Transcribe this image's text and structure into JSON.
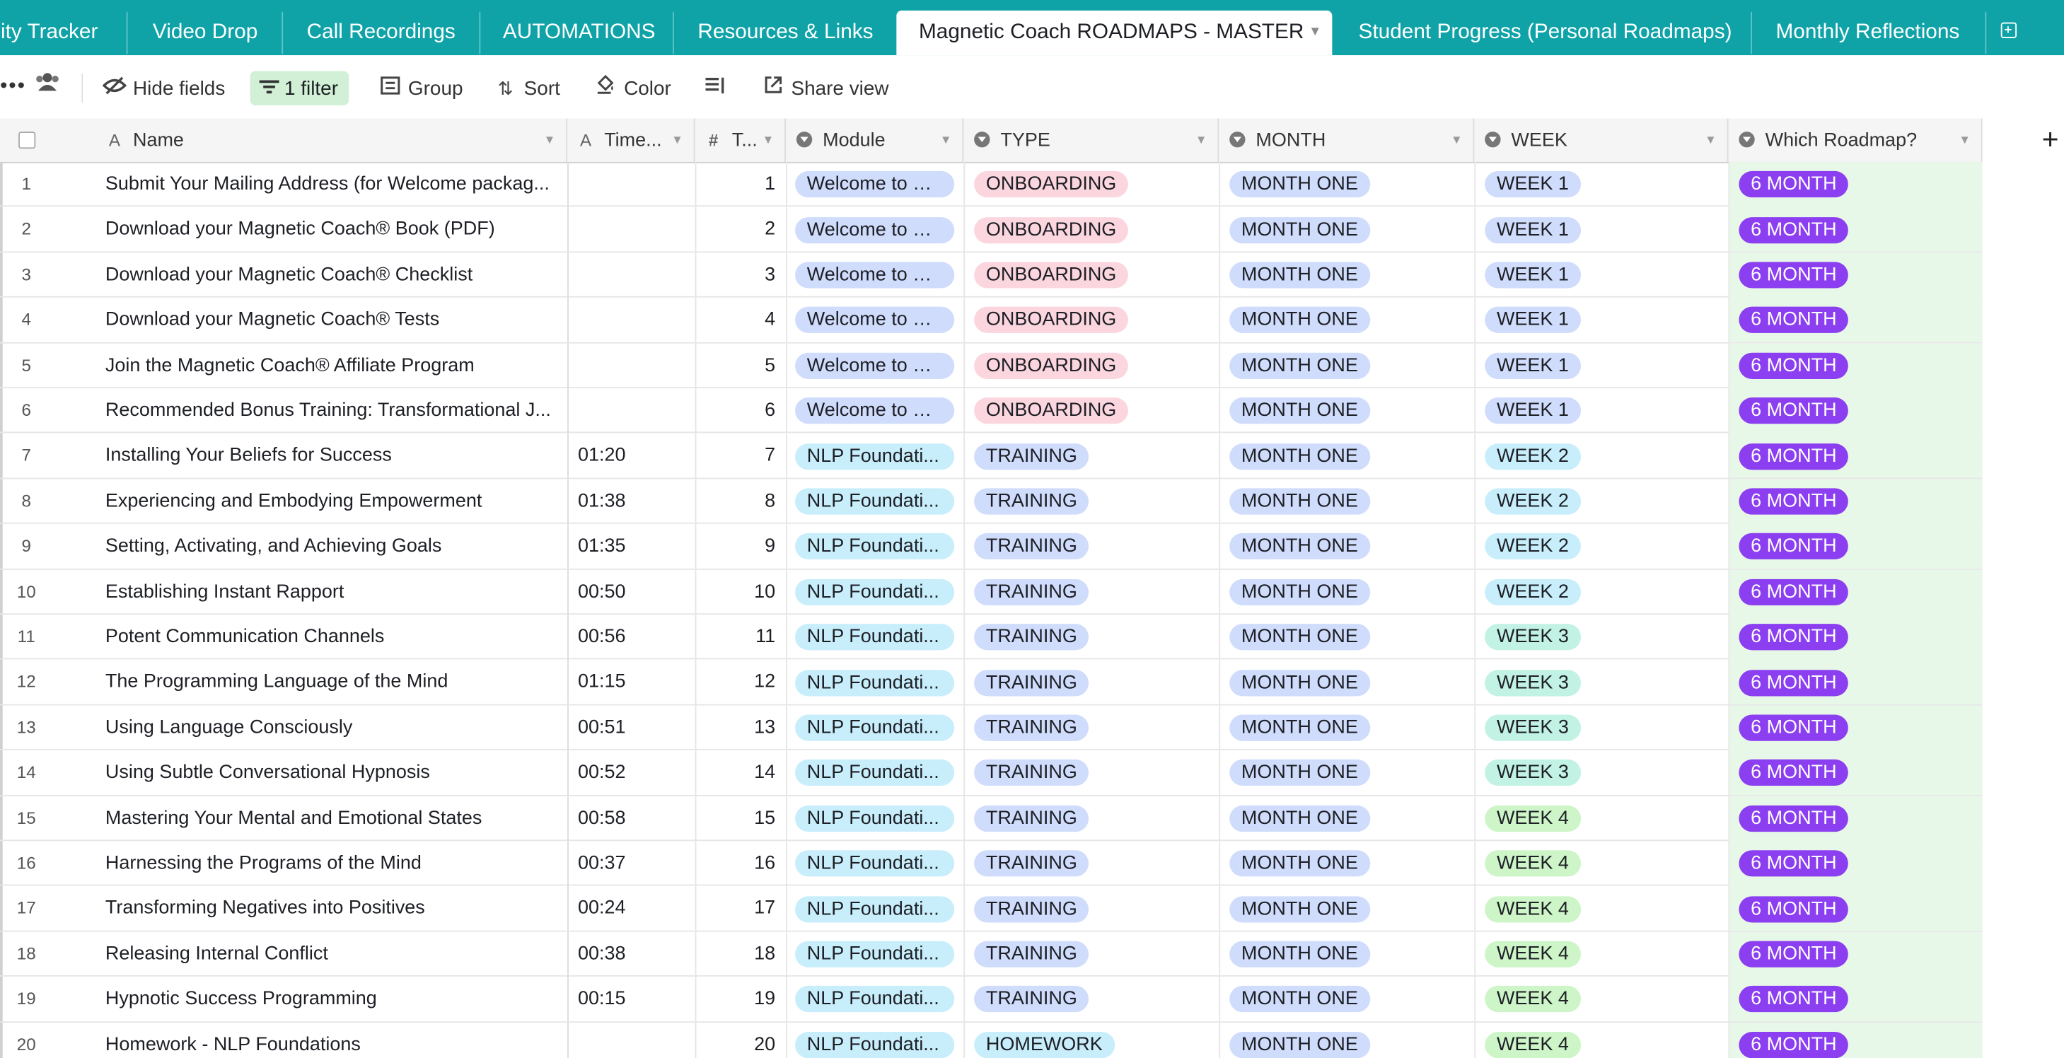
{
  "tabs": [
    {
      "label": "lity Tracker",
      "active": false
    },
    {
      "label": "Video Drop",
      "active": false
    },
    {
      "label": "Call Recordings",
      "active": false
    },
    {
      "label": "AUTOMATIONS",
      "active": false
    },
    {
      "label": "Resources & Links",
      "active": false
    },
    {
      "label": "Magnetic Coach ROADMAPS - MASTER",
      "active": true
    },
    {
      "label": "Student Progress (Personal Roadmaps)",
      "active": false
    },
    {
      "label": "Monthly Reflections",
      "active": false
    }
  ],
  "toolbar": {
    "hide_fields": "Hide fields",
    "filter": "1 filter",
    "group": "Group",
    "sort": "Sort",
    "color": "Color",
    "share_view": "Share view"
  },
  "columns": {
    "name": "Name",
    "time": "Time...",
    "t": "T...",
    "module": "Module",
    "type": "TYPE",
    "month": "MONTH",
    "week": "WEEK",
    "roadmap": "Which Roadmap?"
  },
  "colors": {
    "tab_bar": "#0fa3a8",
    "filter_bg": "#d1f0d5",
    "roadmap_col_bg": "#e8f8e8",
    "pill_roadmap": "#8b3ff0"
  },
  "pill_styles": {
    "Welcome to M...": {
      "bg": "#cfdcfb",
      "fg": "#1d1f25"
    },
    "NLP Foundati...": {
      "bg": "#c8eefc",
      "fg": "#1d1f25"
    },
    "ONBOARDING": {
      "bg": "#fbd6df",
      "fg": "#1d1f25"
    },
    "TRAINING": {
      "bg": "#cfdcfb",
      "fg": "#1d1f25"
    },
    "HOMEWORK": {
      "bg": "#c8eefc",
      "fg": "#1d1f25"
    },
    "MONTH ONE": {
      "bg": "#cfdcfb",
      "fg": "#1d1f25"
    },
    "WEEK 1": {
      "bg": "#cfdcfb",
      "fg": "#1d1f25"
    },
    "WEEK 2": {
      "bg": "#c8eefc",
      "fg": "#1d1f25"
    },
    "WEEK 3": {
      "bg": "#c2f2e4",
      "fg": "#1d1f25"
    },
    "WEEK 4": {
      "bg": "#cdf5c8",
      "fg": "#1d1f25"
    },
    "6 MONTH": {
      "bg": "#8b3ff0",
      "fg": "#ffffff"
    }
  },
  "rows": [
    {
      "num": "1",
      "name": "Submit Your Mailing Address (for Welcome packag...",
      "time": "",
      "t": "1",
      "module": "Welcome to M...",
      "type": "ONBOARDING",
      "month": "MONTH ONE",
      "week": "WEEK 1",
      "roadmap": "6 MONTH"
    },
    {
      "num": "2",
      "name": "Download your Magnetic Coach® Book (PDF)",
      "time": "",
      "t": "2",
      "module": "Welcome to M...",
      "type": "ONBOARDING",
      "month": "MONTH ONE",
      "week": "WEEK 1",
      "roadmap": "6 MONTH"
    },
    {
      "num": "3",
      "name": "Download your Magnetic Coach® Checklist",
      "time": "",
      "t": "3",
      "module": "Welcome to M...",
      "type": "ONBOARDING",
      "month": "MONTH ONE",
      "week": "WEEK 1",
      "roadmap": "6 MONTH"
    },
    {
      "num": "4",
      "name": "Download your Magnetic Coach® Tests",
      "time": "",
      "t": "4",
      "module": "Welcome to M...",
      "type": "ONBOARDING",
      "month": "MONTH ONE",
      "week": "WEEK 1",
      "roadmap": "6 MONTH"
    },
    {
      "num": "5",
      "name": "Join the Magnetic Coach® Affiliate Program",
      "time": "",
      "t": "5",
      "module": "Welcome to M...",
      "type": "ONBOARDING",
      "month": "MONTH ONE",
      "week": "WEEK 1",
      "roadmap": "6 MONTH"
    },
    {
      "num": "6",
      "name": "Recommended Bonus Training: Transformational J...",
      "time": "",
      "t": "6",
      "module": "Welcome to M...",
      "type": "ONBOARDING",
      "month": "MONTH ONE",
      "week": "WEEK 1",
      "roadmap": "6 MONTH"
    },
    {
      "num": "7",
      "name": "Installing Your Beliefs for Success",
      "time": "01:20",
      "t": "7",
      "module": "NLP Foundati...",
      "type": "TRAINING",
      "month": "MONTH ONE",
      "week": "WEEK 2",
      "roadmap": "6 MONTH"
    },
    {
      "num": "8",
      "name": "Experiencing and Embodying Empowerment",
      "time": "01:38",
      "t": "8",
      "module": "NLP Foundati...",
      "type": "TRAINING",
      "month": "MONTH ONE",
      "week": "WEEK 2",
      "roadmap": "6 MONTH"
    },
    {
      "num": "9",
      "name": "Setting, Activating, and Achieving Goals",
      "time": "01:35",
      "t": "9",
      "module": "NLP Foundati...",
      "type": "TRAINING",
      "month": "MONTH ONE",
      "week": "WEEK 2",
      "roadmap": "6 MONTH"
    },
    {
      "num": "10",
      "name": "Establishing Instant Rapport",
      "time": "00:50",
      "t": "10",
      "module": "NLP Foundati...",
      "type": "TRAINING",
      "month": "MONTH ONE",
      "week": "WEEK 2",
      "roadmap": "6 MONTH"
    },
    {
      "num": "11",
      "name": "Potent Communication Channels",
      "time": "00:56",
      "t": "11",
      "module": "NLP Foundati...",
      "type": "TRAINING",
      "month": "MONTH ONE",
      "week": "WEEK 3",
      "roadmap": "6 MONTH"
    },
    {
      "num": "12",
      "name": "The Programming Language of the Mind",
      "time": "01:15",
      "t": "12",
      "module": "NLP Foundati...",
      "type": "TRAINING",
      "month": "MONTH ONE",
      "week": "WEEK 3",
      "roadmap": "6 MONTH"
    },
    {
      "num": "13",
      "name": "Using Language Consciously",
      "time": "00:51",
      "t": "13",
      "module": "NLP Foundati...",
      "type": "TRAINING",
      "month": "MONTH ONE",
      "week": "WEEK 3",
      "roadmap": "6 MONTH"
    },
    {
      "num": "14",
      "name": "Using Subtle Conversational Hypnosis",
      "time": "00:52",
      "t": "14",
      "module": "NLP Foundati...",
      "type": "TRAINING",
      "month": "MONTH ONE",
      "week": "WEEK 3",
      "roadmap": "6 MONTH"
    },
    {
      "num": "15",
      "name": "Mastering Your Mental and Emotional States",
      "time": "00:58",
      "t": "15",
      "module": "NLP Foundati...",
      "type": "TRAINING",
      "month": "MONTH ONE",
      "week": "WEEK 4",
      "roadmap": "6 MONTH"
    },
    {
      "num": "16",
      "name": "Harnessing the Programs of the Mind",
      "time": "00:37",
      "t": "16",
      "module": "NLP Foundati...",
      "type": "TRAINING",
      "month": "MONTH ONE",
      "week": "WEEK 4",
      "roadmap": "6 MONTH"
    },
    {
      "num": "17",
      "name": "Transforming Negatives into Positives",
      "time": "00:24",
      "t": "17",
      "module": "NLP Foundati...",
      "type": "TRAINING",
      "month": "MONTH ONE",
      "week": "WEEK 4",
      "roadmap": "6 MONTH"
    },
    {
      "num": "18",
      "name": "Releasing Internal Conflict",
      "time": "00:38",
      "t": "18",
      "module": "NLP Foundati...",
      "type": "TRAINING",
      "month": "MONTH ONE",
      "week": "WEEK 4",
      "roadmap": "6 MONTH"
    },
    {
      "num": "19",
      "name": "Hypnotic Success Programming",
      "time": "00:15",
      "t": "19",
      "module": "NLP Foundati...",
      "type": "TRAINING",
      "month": "MONTH ONE",
      "week": "WEEK 4",
      "roadmap": "6 MONTH"
    },
    {
      "num": "20",
      "name": "Homework - NLP Foundations",
      "time": "",
      "t": "20",
      "module": "NLP Foundati...",
      "type": "HOMEWORK",
      "month": "MONTH ONE",
      "week": "WEEK 4",
      "roadmap": "6 MONTH"
    }
  ]
}
